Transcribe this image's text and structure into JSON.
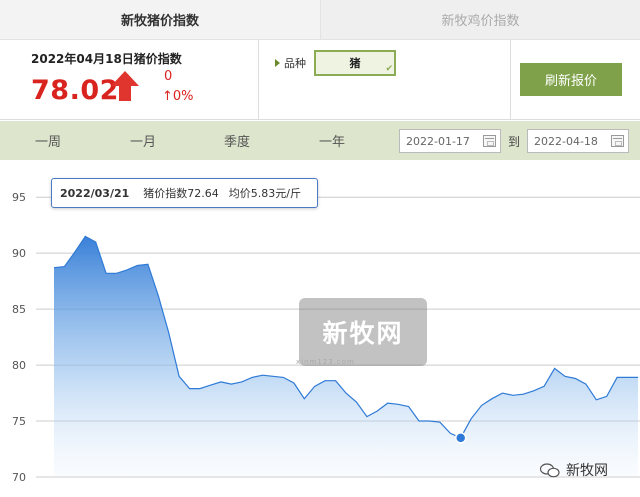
{
  "tabs": {
    "active": "新牧猪价指数",
    "inactive": "新牧鸡价指数"
  },
  "index": {
    "title": "2022年04月18日猪价指数",
    "value": "78.02",
    "change_abs": "0",
    "change_pct": "↑0%"
  },
  "variety": {
    "label": "品种",
    "selected": "猪"
  },
  "refresh_label": "刷新报价",
  "periods": [
    "一周",
    "一月",
    "季度",
    "一年"
  ],
  "date_range": {
    "start": "2022-01-17",
    "to": "到",
    "end": "2022-04-18"
  },
  "tooltip": {
    "date": "2022/03/21",
    "index_text": "猪价指数72.64",
    "avg_text": "均价5.83元/斤"
  },
  "watermark": {
    "text": "新牧网",
    "sub": "xinm123.com"
  },
  "corner_logo": "新牧网",
  "colors": {
    "accent": "#7ea149",
    "up": "#d9231e",
    "line": "#2f7ad6"
  },
  "chart_data": {
    "type": "area",
    "yticks": [
      70,
      75,
      80,
      85,
      90,
      95
    ],
    "ylim": [
      70,
      96
    ],
    "y": [
      88.7,
      88.8,
      90.1,
      91.5,
      91.0,
      88.2,
      88.2,
      88.5,
      88.9,
      89.0,
      86.2,
      82.9,
      79.0,
      77.9,
      77.9,
      78.2,
      78.5,
      78.3,
      78.5,
      78.9,
      79.1,
      79.0,
      78.9,
      78.4,
      77.0,
      78.1,
      78.6,
      78.6,
      77.5,
      76.7,
      75.4,
      75.9,
      76.6,
      76.5,
      76.3,
      75.0,
      75.0,
      74.9,
      73.9,
      73.5,
      75.2,
      76.4,
      77.0,
      77.5,
      77.3,
      77.4,
      77.7,
      78.1,
      79.7,
      79.0,
      78.8,
      78.3,
      76.9,
      77.2,
      78.9,
      78.9,
      78.9
    ],
    "highlight": {
      "date": "2022/03/21",
      "value": 73.5
    },
    "grid": true,
    "legend": "none"
  }
}
